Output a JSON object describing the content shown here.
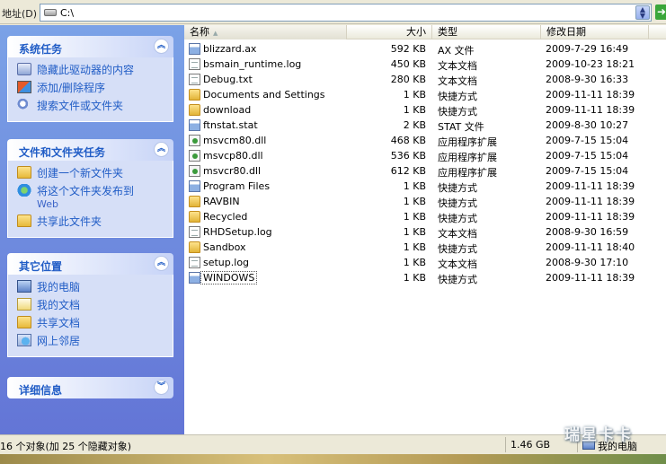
{
  "address": {
    "label": "地址(D)",
    "path": "C:\\",
    "dropdown_icon": "down-arrow-icon",
    "go_icon": "go-arrow-icon"
  },
  "tasks_pane": {
    "system": {
      "title": "系统任务",
      "items": [
        {
          "icon": "drive-icon",
          "label": "隐藏此驱动器的内容"
        },
        {
          "icon": "add-remove-programs-icon",
          "label": "添加/删除程序"
        },
        {
          "icon": "search-icon",
          "label": "搜索文件或文件夹"
        }
      ]
    },
    "file_folder": {
      "title": "文件和文件夹任务",
      "items": [
        {
          "icon": "new-folder-icon",
          "label": "创建一个新文件夹"
        },
        {
          "icon": "publish-web-icon",
          "label": "将这个文件夹发布到",
          "sub": "Web"
        },
        {
          "icon": "share-folder-icon",
          "label": "共享此文件夹"
        }
      ]
    },
    "other_places": {
      "title": "其它位置",
      "items": [
        {
          "icon": "my-computer-icon",
          "label": "我的电脑"
        },
        {
          "icon": "my-documents-icon",
          "label": "我的文档"
        },
        {
          "icon": "shared-documents-icon",
          "label": "共享文档"
        },
        {
          "icon": "network-places-icon",
          "label": "网上邻居"
        }
      ]
    },
    "details": {
      "title": "详细信息"
    }
  },
  "columns": {
    "name": "名称",
    "size": "大小",
    "type": "类型",
    "date": "修改日期"
  },
  "files": [
    {
      "icon": "sys",
      "name": "blizzard.ax",
      "size": "592 KB",
      "type": "AX 文件",
      "date": "2009-7-29 16:49"
    },
    {
      "icon": "doc",
      "name": "bsmain_runtime.log",
      "size": "450 KB",
      "type": "文本文档",
      "date": "2009-10-23 18:21"
    },
    {
      "icon": "doc",
      "name": "Debug.txt",
      "size": "280 KB",
      "type": "文本文档",
      "date": "2008-9-30 16:33"
    },
    {
      "icon": "folder",
      "name": "Documents and Settings",
      "size": "1 KB",
      "type": "快捷方式",
      "date": "2009-11-11 18:39"
    },
    {
      "icon": "folder",
      "name": "download",
      "size": "1 KB",
      "type": "快捷方式",
      "date": "2009-11-11 18:39"
    },
    {
      "icon": "sys",
      "name": "ftnstat.stat",
      "size": "2 KB",
      "type": "STAT 文件",
      "date": "2009-8-30 10:27"
    },
    {
      "icon": "dll",
      "name": "msvcm80.dll",
      "size": "468 KB",
      "type": "应用程序扩展",
      "date": "2009-7-15 15:04"
    },
    {
      "icon": "dll",
      "name": "msvcp80.dll",
      "size": "536 KB",
      "type": "应用程序扩展",
      "date": "2009-7-15 15:04"
    },
    {
      "icon": "dll",
      "name": "msvcr80.dll",
      "size": "612 KB",
      "type": "应用程序扩展",
      "date": "2009-7-15 15:04"
    },
    {
      "icon": "sys",
      "name": "Program Files",
      "size": "1 KB",
      "type": "快捷方式",
      "date": "2009-11-11 18:39"
    },
    {
      "icon": "folder",
      "name": "RAVBIN",
      "size": "1 KB",
      "type": "快捷方式",
      "date": "2009-11-11 18:39"
    },
    {
      "icon": "folder",
      "name": "Recycled",
      "size": "1 KB",
      "type": "快捷方式",
      "date": "2009-11-11 18:39"
    },
    {
      "icon": "doc",
      "name": "RHDSetup.log",
      "size": "1 KB",
      "type": "文本文档",
      "date": "2008-9-30 16:59"
    },
    {
      "icon": "folder",
      "name": "Sandbox",
      "size": "1 KB",
      "type": "快捷方式",
      "date": "2009-11-11 18:40"
    },
    {
      "icon": "doc",
      "name": "setup.log",
      "size": "1 KB",
      "type": "文本文档",
      "date": "2008-9-30 17:10"
    },
    {
      "icon": "sys",
      "name": "WINDOWS",
      "size": "1 KB",
      "type": "快捷方式",
      "date": "2009-11-11 18:39",
      "selected": true
    }
  ],
  "status": {
    "objects": "16 个对象(加 25 个隐藏对象)",
    "size": "1.46 GB",
    "location": "我的电脑"
  },
  "watermark": "瑞星卡卡"
}
